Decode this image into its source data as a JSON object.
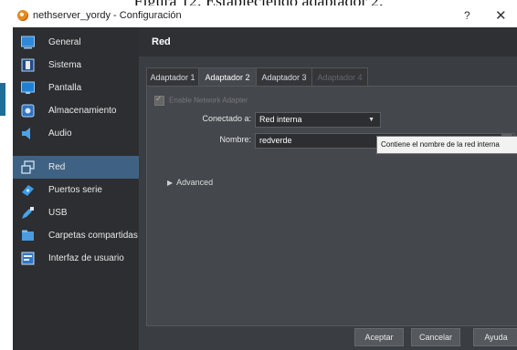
{
  "caption": "Figura 12. Estableciendo adaptador 2.",
  "window": {
    "title": "nethserver_yordy - Configuración",
    "help_label": "?",
    "close_label": "✕"
  },
  "sidebar": {
    "items": [
      {
        "label": "General",
        "icon": "general-icon"
      },
      {
        "label": "Sistema",
        "icon": "system-icon"
      },
      {
        "label": "Pantalla",
        "icon": "display-icon"
      },
      {
        "label": "Almacenamiento",
        "icon": "storage-icon"
      },
      {
        "label": "Audio",
        "icon": "audio-icon"
      },
      {
        "label": "Red",
        "icon": "network-icon",
        "selected": true
      },
      {
        "label": "Puertos serie",
        "icon": "serial-ports-icon"
      },
      {
        "label": "USB",
        "icon": "usb-icon"
      },
      {
        "label": "Carpetas compartidas",
        "icon": "shared-folders-icon"
      },
      {
        "label": "Interfaz de usuario",
        "icon": "user-interface-icon"
      }
    ]
  },
  "main": {
    "section_title": "Red",
    "tabs": [
      {
        "label": "Adaptador 1"
      },
      {
        "label": "Adaptador 2",
        "active": true
      },
      {
        "label": "Adaptador 3"
      },
      {
        "label": "Adaptador 4",
        "disabled": true
      }
    ],
    "enable_adapter_label": "Enable Network Adapter",
    "connected_label": "Conectado a:",
    "connected_value": "Red interna",
    "name_label": "Nombre:",
    "name_value": "redverde",
    "advanced_label": "Advanced",
    "tooltip": "Contiene el nombre de la red interna"
  },
  "footer": {
    "ok_label": "Aceptar",
    "cancel_label": "Cancelar",
    "help_label": "Ayuda"
  },
  "colors": {
    "selected_item": "#3f6284",
    "background": "#3a3d41"
  }
}
